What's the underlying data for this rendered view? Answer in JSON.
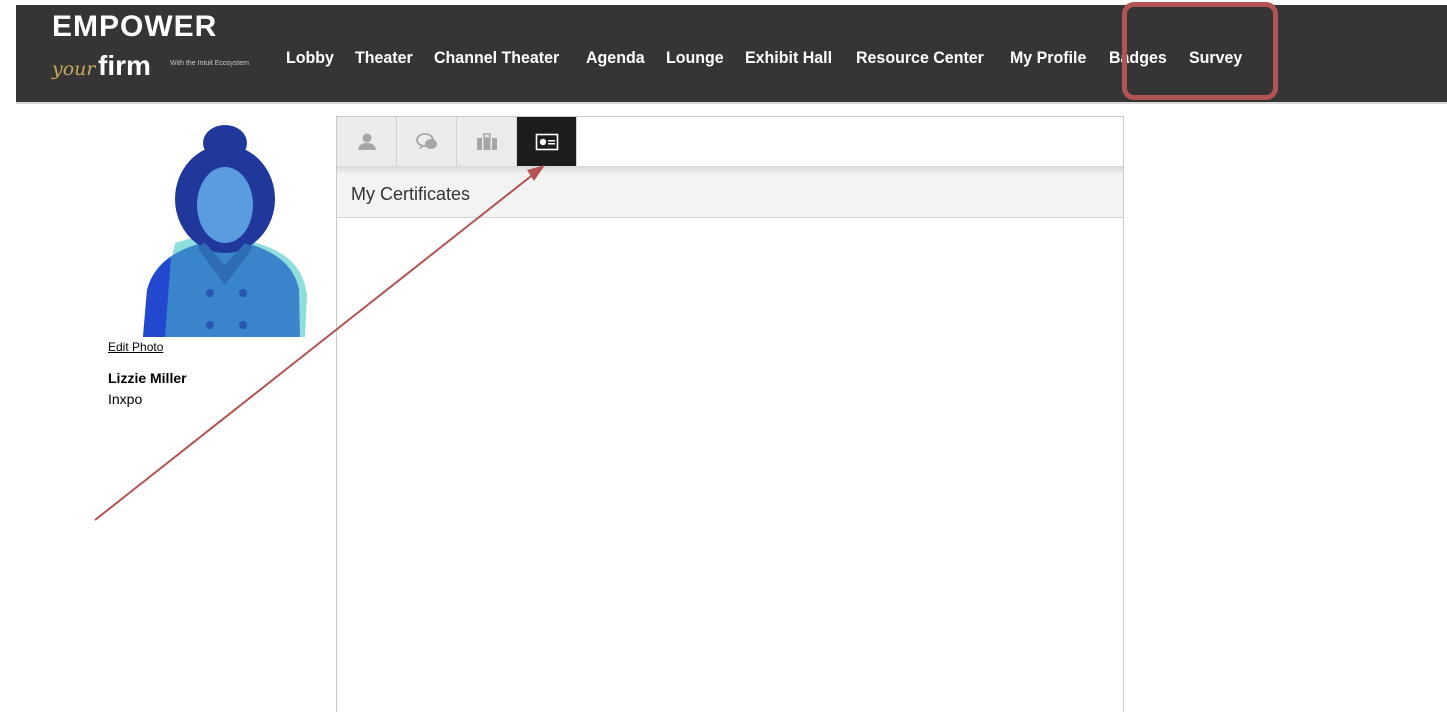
{
  "brand": {
    "logo_top": "EMPOWER",
    "logo_your": "your",
    "logo_firm": "firm",
    "logo_tagline": "With the Intuit Ecosystem"
  },
  "nav": {
    "items": [
      "Lobby",
      "Theater",
      "Channel Theater",
      "Agenda",
      "Lounge",
      "Exhibit Hall",
      "Resource Center",
      "My Profile",
      "Badges",
      "Survey"
    ]
  },
  "profile": {
    "edit_photo": "Edit Photo",
    "name": "Lizzie Miller",
    "company": "Inxpo"
  },
  "panel": {
    "title": "My Certificates",
    "tabs": [
      {
        "icon": "person-icon",
        "active": false
      },
      {
        "icon": "chat-icon",
        "active": false
      },
      {
        "icon": "briefcase-icon",
        "active": false
      },
      {
        "icon": "certificate-icon",
        "active": true
      }
    ]
  },
  "colors": {
    "nav_bg": "#353535",
    "highlight": "#b35353",
    "arrow": "#b35353"
  }
}
